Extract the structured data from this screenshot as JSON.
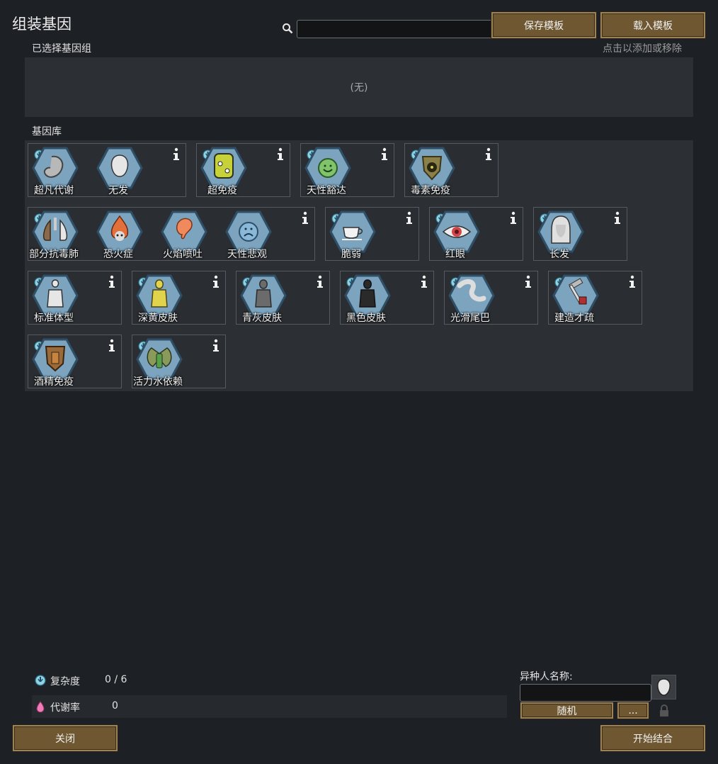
{
  "window": {
    "title": "组装基因"
  },
  "toolbar": {
    "search_placeholder": "",
    "save_label": "保存模板",
    "load_label": "载入模板"
  },
  "selected": {
    "label": "已选择基因组",
    "hint": "点击以添加或移除",
    "empty_text": "(无)"
  },
  "library": {
    "label": "基因库",
    "groups": [
      {
        "complexity": "0",
        "genes": [
          {
            "name": "超凡代谢",
            "icon": "stomach-icon"
          },
          {
            "name": "无发",
            "icon": "bald-head-icon"
          }
        ]
      },
      {
        "complexity": "0",
        "genes": [
          {
            "name": "超免疫",
            "icon": "immune-cell-icon"
          }
        ]
      },
      {
        "complexity": "0",
        "genes": [
          {
            "name": "天性豁达",
            "icon": "happy-face-icon"
          }
        ]
      },
      {
        "complexity": "0",
        "genes": [
          {
            "name": "毒素免疫",
            "icon": "toxic-shield-icon"
          }
        ]
      },
      {
        "complexity": "0",
        "genes": [
          {
            "name": "部分抗毒肺",
            "icon": "lungs-icon"
          },
          {
            "name": "恐火症",
            "icon": "fire-skull-icon"
          },
          {
            "name": "火焰喷吐",
            "icon": "fire-breath-icon"
          },
          {
            "name": "天性悲观",
            "icon": "sad-face-icon"
          }
        ]
      },
      {
        "complexity": "0",
        "genes": [
          {
            "name": "脆弱",
            "icon": "teacup-icon"
          }
        ]
      },
      {
        "complexity": "0",
        "genes": [
          {
            "name": "红眼",
            "icon": "red-eye-icon"
          }
        ]
      },
      {
        "complexity": "0",
        "genes": [
          {
            "name": "长发",
            "icon": "long-hair-icon"
          }
        ]
      },
      {
        "complexity": "0",
        "genes": [
          {
            "name": "标准体型",
            "icon": "body-standard-icon"
          }
        ]
      },
      {
        "complexity": "0",
        "genes": [
          {
            "name": "深黄皮肤",
            "icon": "skin-yellow-icon"
          }
        ]
      },
      {
        "complexity": "0",
        "genes": [
          {
            "name": "青灰皮肤",
            "icon": "skin-gray-icon"
          }
        ]
      },
      {
        "complexity": "0",
        "genes": [
          {
            "name": "黑色皮肤",
            "icon": "skin-black-icon"
          }
        ]
      },
      {
        "complexity": "0",
        "genes": [
          {
            "name": "光滑尾巴",
            "icon": "tail-icon"
          }
        ]
      },
      {
        "complexity": "0",
        "genes": [
          {
            "name": "建造才疏",
            "icon": "hammer-icon"
          }
        ]
      },
      {
        "complexity": "0",
        "genes": [
          {
            "name": "酒精免疫",
            "icon": "beer-shield-icon"
          }
        ]
      },
      {
        "complexity": "0",
        "genes": [
          {
            "name": "活力水依赖",
            "icon": "go-juice-icon"
          }
        ]
      }
    ]
  },
  "stats": {
    "complexity_label": "复杂度",
    "complexity_value": "0 / 6",
    "metabolism_label": "代谢率",
    "metabolism_value": "0"
  },
  "xenotype": {
    "name_label": "异种人名称:",
    "name_value": "",
    "random_label": "随机",
    "more_label": "..."
  },
  "footer": {
    "close_label": "关闭",
    "start_label": "开始结合"
  },
  "colors": {
    "hex_fill": "#7ca4bf",
    "hex_border": "#2f4f66",
    "button": "#6e5731",
    "panel": "#2c2f33",
    "background": "#1d2024"
  }
}
